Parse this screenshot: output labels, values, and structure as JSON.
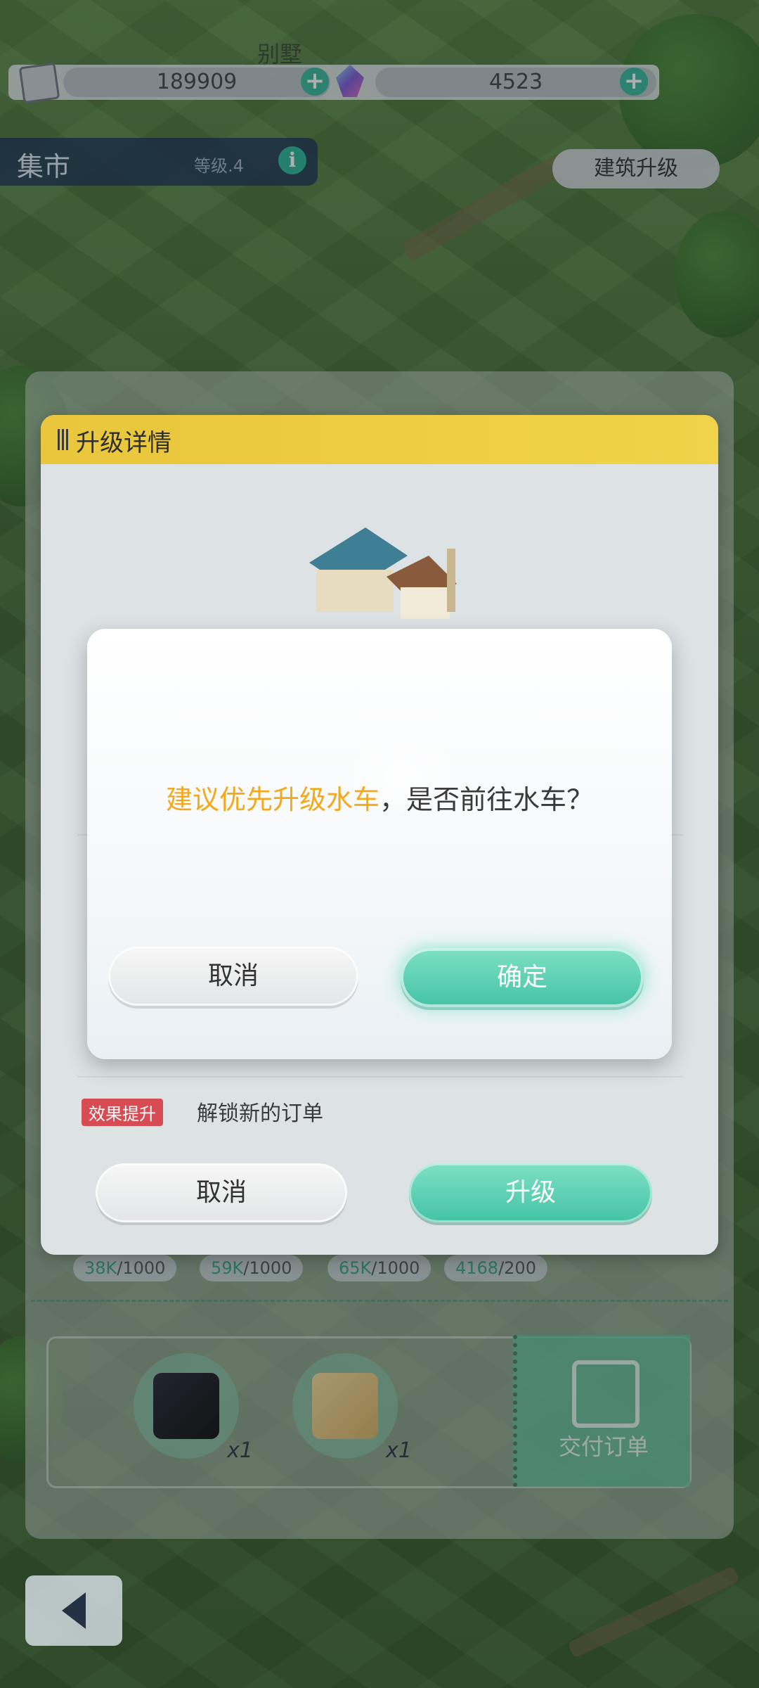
{
  "map": {
    "location_label": "别墅"
  },
  "resources": [
    {
      "icon": "silver-ore-icon",
      "value": "189909",
      "add_label": "+"
    },
    {
      "icon": "crystal-gem-icon",
      "value": "4523",
      "add_label": "+"
    }
  ],
  "building": {
    "name": "集市",
    "level": "等级.4",
    "info_label": "i"
  },
  "upgrade_building_button": "建筑升级",
  "detail_panel": {
    "title": "升级详情",
    "effect_tag": "效果提升",
    "effect_text": "解锁新的订单",
    "cancel_label": "取消",
    "upgrade_label": "升级"
  },
  "dialog": {
    "message_highlight": "建议优先升级水车",
    "message_rest": "，是否前往水车？",
    "cancel_label": "取消",
    "confirm_label": "确定"
  },
  "order": {
    "requirements": [
      {
        "have": "38K",
        "need": "/1000"
      },
      {
        "have": "59K",
        "need": "/1000"
      },
      {
        "have": "65K",
        "need": "/1000"
      },
      {
        "have": "4168",
        "need": "/200"
      }
    ],
    "rewards": [
      {
        "icon": "mystery-box-icon",
        "count": "x1"
      },
      {
        "icon": "gift-box-icon",
        "count": "x1"
      }
    ],
    "deliver_label": "交付订单"
  },
  "colors": {
    "accent_green": "#44c3a6",
    "highlight_orange": "#f4a81c",
    "header_yellow": "#e9c63b",
    "effect_red": "#d64c52"
  }
}
